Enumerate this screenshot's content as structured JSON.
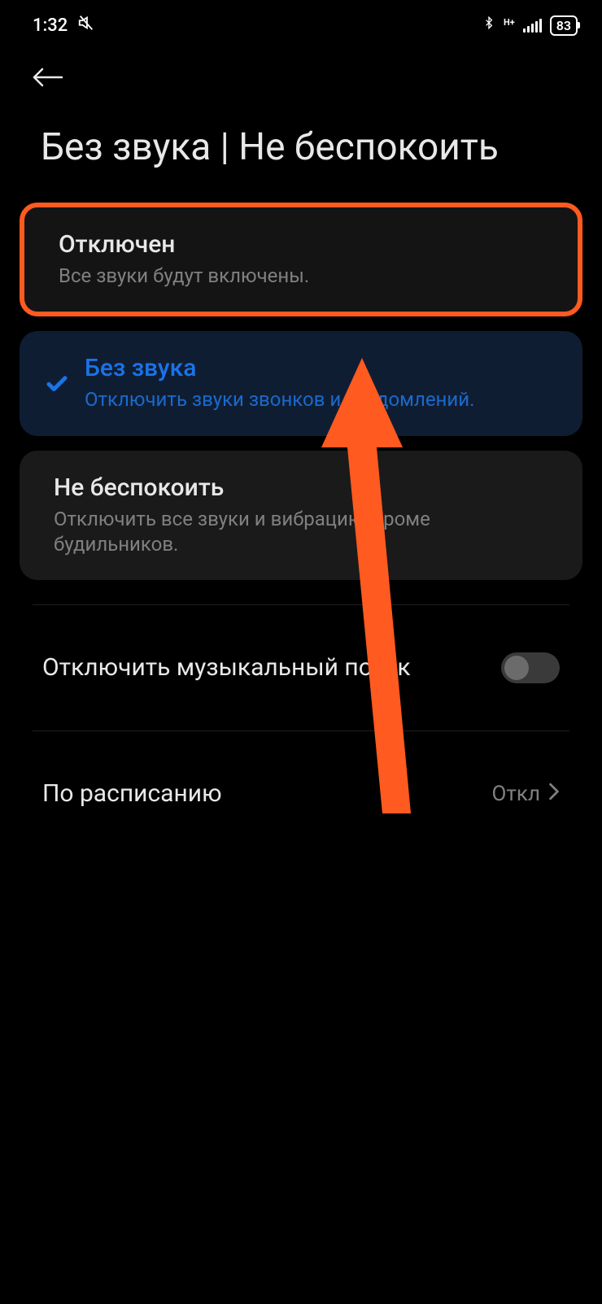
{
  "status": {
    "time": "1:32",
    "network_label": "H+",
    "battery": "83"
  },
  "page": {
    "title": "Без звука | Не беспокоить"
  },
  "options": [
    {
      "title": "Отключен",
      "subtitle": "Все звуки будут включены."
    },
    {
      "title": "Без звука",
      "subtitle": "Отключить звуки звонков и уведомлений."
    },
    {
      "title": "Не беспокоить",
      "subtitle": "Отключить все звуки и вибрацию, кроме будильников."
    }
  ],
  "settings": {
    "mute_stream_label": "Отключить музыкальный поток",
    "schedule_label": "По расписанию",
    "schedule_value": "Откл"
  },
  "annotation": {
    "color": "#ff5a1f"
  }
}
